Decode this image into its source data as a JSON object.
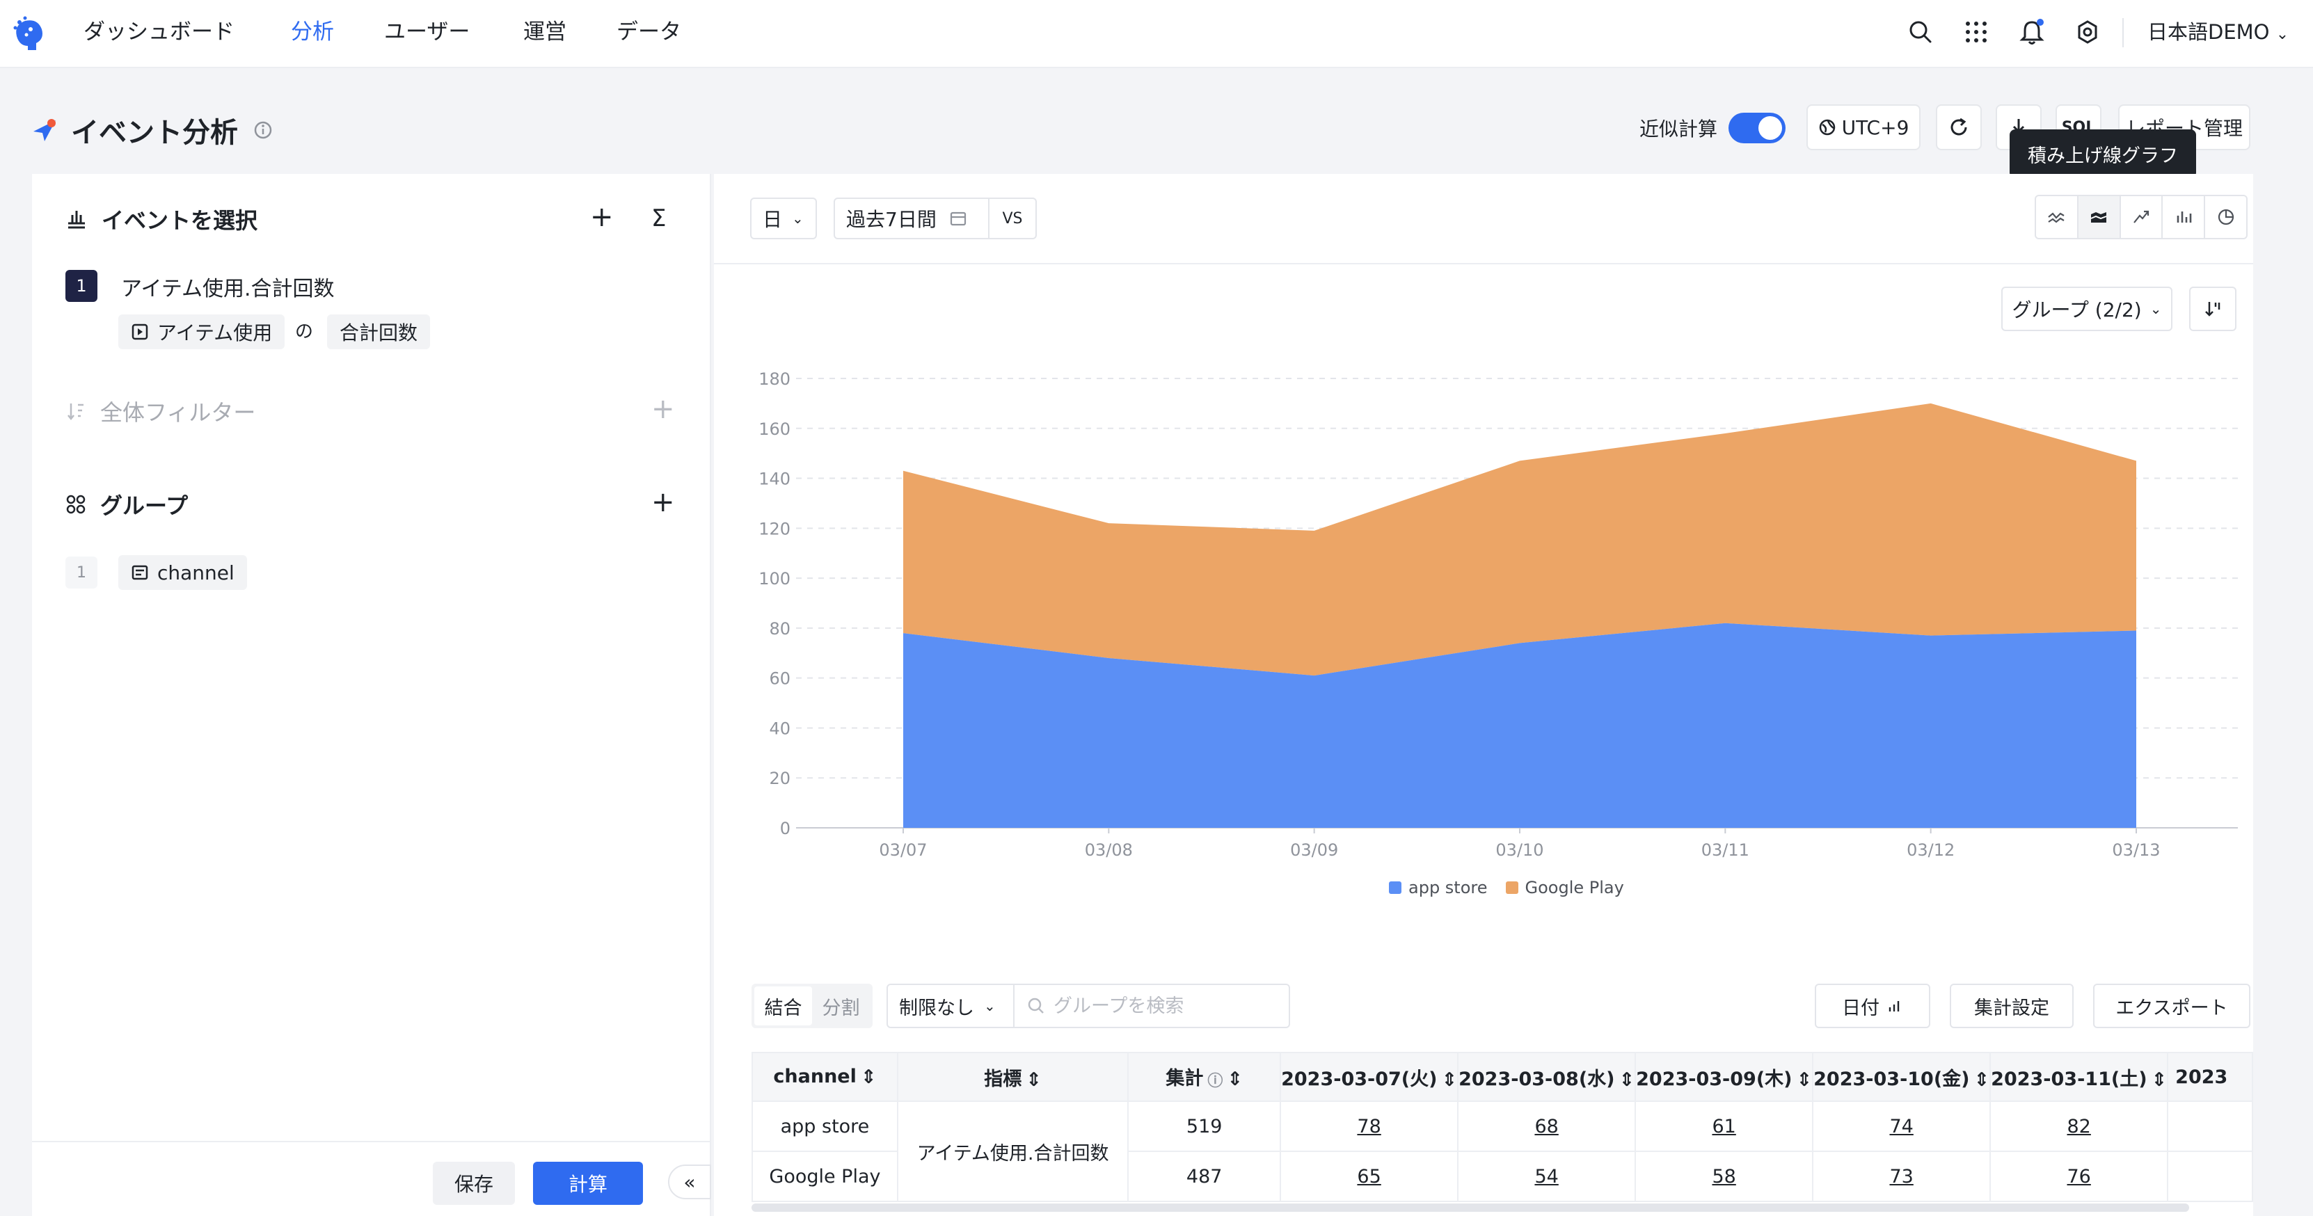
{
  "nav": {
    "items": [
      "ダッシュボード",
      "分析",
      "ユーザー",
      "運営",
      "データ"
    ],
    "active_index": 1,
    "user_label": "日本語DEMO"
  },
  "header": {
    "title": "イベント分析",
    "approx_label": "近似計算",
    "approx_on": true,
    "timezone": "UTC+9",
    "sql_label": "SQL",
    "report_label": "レポート管理",
    "tooltip": "積み上げ線グラフ"
  },
  "left": {
    "events_title": "イベントを選択",
    "sigma": "Σ",
    "event": {
      "index": "1",
      "name": "アイテム使用.合計回数",
      "chip_event": "アイテム使用",
      "of": "の",
      "chip_metric": "合計回数"
    },
    "filter_title": "全体フィルター",
    "group_title": "グループ",
    "group": {
      "index": "1",
      "field": "channel"
    },
    "save_label": "保存",
    "calc_label": "計算",
    "collapse_label": "«"
  },
  "toolbar": {
    "granularity": "日",
    "range": "過去7日間",
    "vs": "VS",
    "group_select": "グループ (2/2)"
  },
  "colors": {
    "app_store": "#5b8ff5",
    "google_play": "#eca566",
    "accent": "#2f6bf0"
  },
  "chart_data": {
    "type": "area",
    "stacked": true,
    "x": [
      "03/07",
      "03/08",
      "03/09",
      "03/10",
      "03/11",
      "03/12",
      "03/13"
    ],
    "series": [
      {
        "name": "app store",
        "values": [
          78,
          68,
          61,
          74,
          82,
          77,
          79
        ]
      },
      {
        "name": "Google Play",
        "values": [
          65,
          54,
          58,
          73,
          76,
          93,
          68
        ]
      }
    ],
    "ylim": [
      0,
      180
    ],
    "yticks": [
      0,
      20,
      40,
      60,
      80,
      100,
      120,
      140,
      160,
      180
    ],
    "grid": true,
    "legend_position": "bottom"
  },
  "table_toolbar": {
    "seg_combined": "結合",
    "seg_split": "分割",
    "limit": "制限なし",
    "search_placeholder": "グループを検索",
    "date_button": "日付",
    "agg_button": "集計設定",
    "export_button": "エクスポート"
  },
  "table": {
    "headers": [
      "channel",
      "指標",
      "集計",
      "2023-03-07(火)",
      "2023-03-08(水)",
      "2023-03-09(木)",
      "2023-03-10(金)",
      "2023-03-11(土)",
      "2023"
    ],
    "metric_name": "アイテム使用.合計回数",
    "rows": [
      {
        "channel": "app store",
        "total": "519",
        "values": [
          "78",
          "68",
          "61",
          "74",
          "82"
        ]
      },
      {
        "channel": "Google Play",
        "total": "487",
        "values": [
          "65",
          "54",
          "58",
          "73",
          "76"
        ]
      }
    ]
  }
}
